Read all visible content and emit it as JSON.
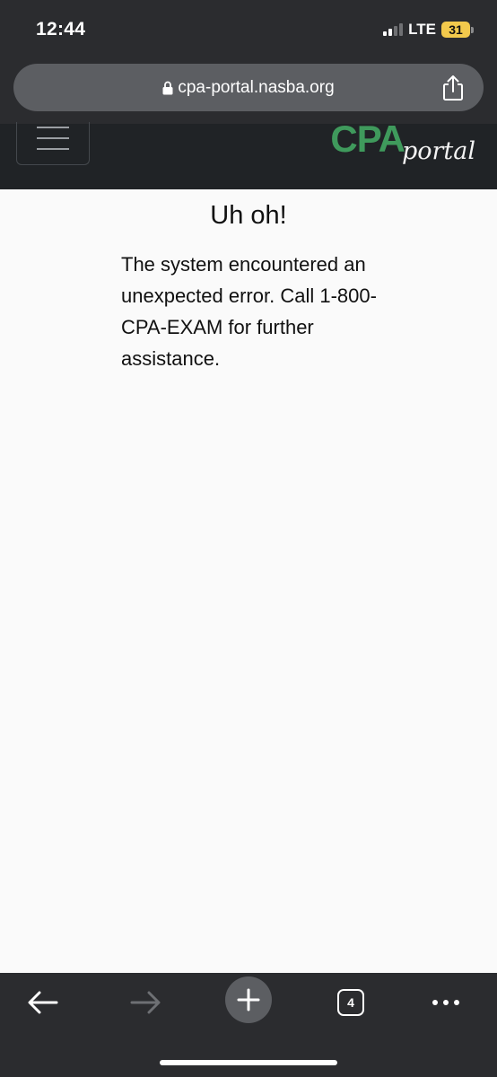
{
  "status_bar": {
    "time": "12:44",
    "network": "LTE",
    "battery": "31"
  },
  "browser": {
    "url": "cpa-portal.nasba.org",
    "tab_count": "4"
  },
  "site_header": {
    "logo_primary": "CPA",
    "logo_secondary": "portal",
    "logo_color": "#3f9a5c"
  },
  "error": {
    "title": "Uh oh!",
    "message": "The system encountered an unexpected error. Call 1-800-CPA-EXAM for further assistance."
  },
  "icons": {
    "lock": "lock-icon",
    "share": "share-icon",
    "menu": "hamburger-icon",
    "back": "back-arrow-icon",
    "forward": "forward-arrow-icon",
    "new_tab": "plus-icon",
    "tabs": "tabs-icon",
    "more": "more-icon"
  }
}
